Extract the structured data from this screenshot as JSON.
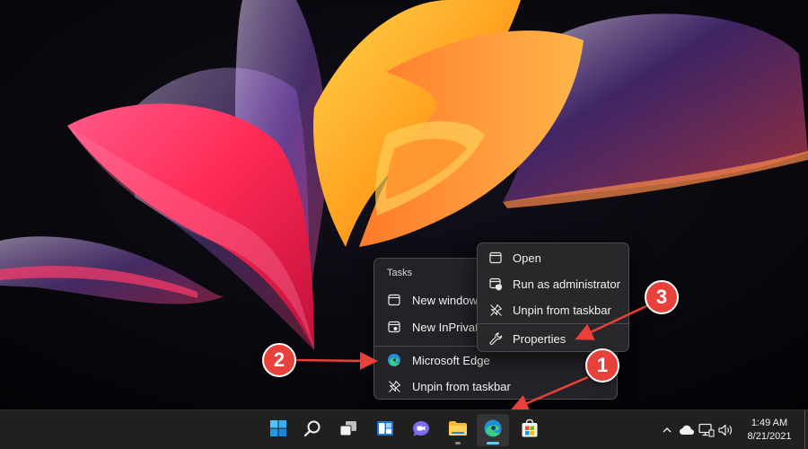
{
  "jump_list": {
    "header": "Tasks",
    "items": [
      {
        "label": "New window",
        "icon": "window-icon"
      },
      {
        "label": "New InPrivate",
        "icon": "inprivate-window-icon"
      },
      {
        "label": "Microsoft Edge",
        "icon": "edge-icon"
      },
      {
        "label": "Unpin from taskbar",
        "icon": "unpin-icon"
      }
    ]
  },
  "context_menu": {
    "items": [
      {
        "label": "Open",
        "icon": "window-icon"
      },
      {
        "label": "Run as administrator",
        "icon": "shield-window-icon"
      },
      {
        "label": "Unpin from taskbar",
        "icon": "unpin-icon"
      },
      {
        "label": "Properties",
        "icon": "wrench-icon"
      }
    ]
  },
  "annotations": {
    "badge_1": "1",
    "badge_2": "2",
    "badge_3": "3",
    "color": "#e8403a"
  },
  "taskbar": {
    "apps": [
      "start-icon",
      "search-icon",
      "task-view-icon",
      "widgets-icon",
      "chat-icon",
      "file-explorer-icon",
      "edge-icon",
      "store-icon"
    ],
    "active_app": "edge-icon",
    "accent": "#60cdff"
  },
  "tray": {
    "icons": [
      "chevron-up-icon",
      "cloud-icon",
      "network-icon",
      "volume-icon"
    ],
    "time": "1:49 AM",
    "date": "8/21/2021"
  }
}
